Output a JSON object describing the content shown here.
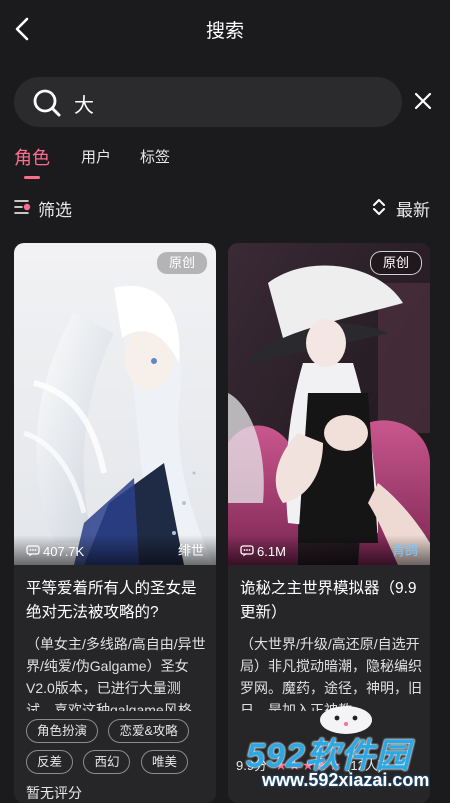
{
  "header": {
    "title": "搜索",
    "back_icon": "chevron-left-icon"
  },
  "search": {
    "value": "大",
    "icon": "search-icon",
    "clear_icon": "close-icon"
  },
  "tabs": [
    {
      "label": "角色",
      "active": true
    },
    {
      "label": "用户",
      "active": false
    },
    {
      "label": "标签",
      "active": false
    }
  ],
  "toolbar": {
    "filter_label": "筛选",
    "sort_label": "最新"
  },
  "colors": {
    "accent": "#ff6d8e",
    "background": "#1b1b1d",
    "card": "#262629"
  },
  "cards": [
    {
      "badge": "原创",
      "chat_count": "407.7K",
      "author": "绯世",
      "title": "平等爱着所有人的圣女是绝对无法被攻略的?",
      "description": "（单女主/多线路/高自由/异世界/纯爱/伪Galgame）圣女V2.0版本，已进行大量测试，喜欢这种galgame风格...",
      "tags": [
        "角色扮演",
        "恋爱&攻略",
        "反差",
        "西幻",
        "唯美"
      ],
      "rating_text": "暂无评分"
    },
    {
      "badge": "原创",
      "chat_count": "6.1M",
      "author": "肯鸽",
      "title": "诡秘之主世界模拟器（9.9更新）",
      "description": "（大世界/升级/高还原/自选开局）非凡搅动暗潮，隐秘编织罗网。魔药，途径，神明，旧日。是加入正神教...",
      "rating_score": "9.9分",
      "rating_count": "(12人)"
    }
  ],
  "watermark": {
    "main": "592软件园",
    "sub": "www.592xiazai.com"
  }
}
